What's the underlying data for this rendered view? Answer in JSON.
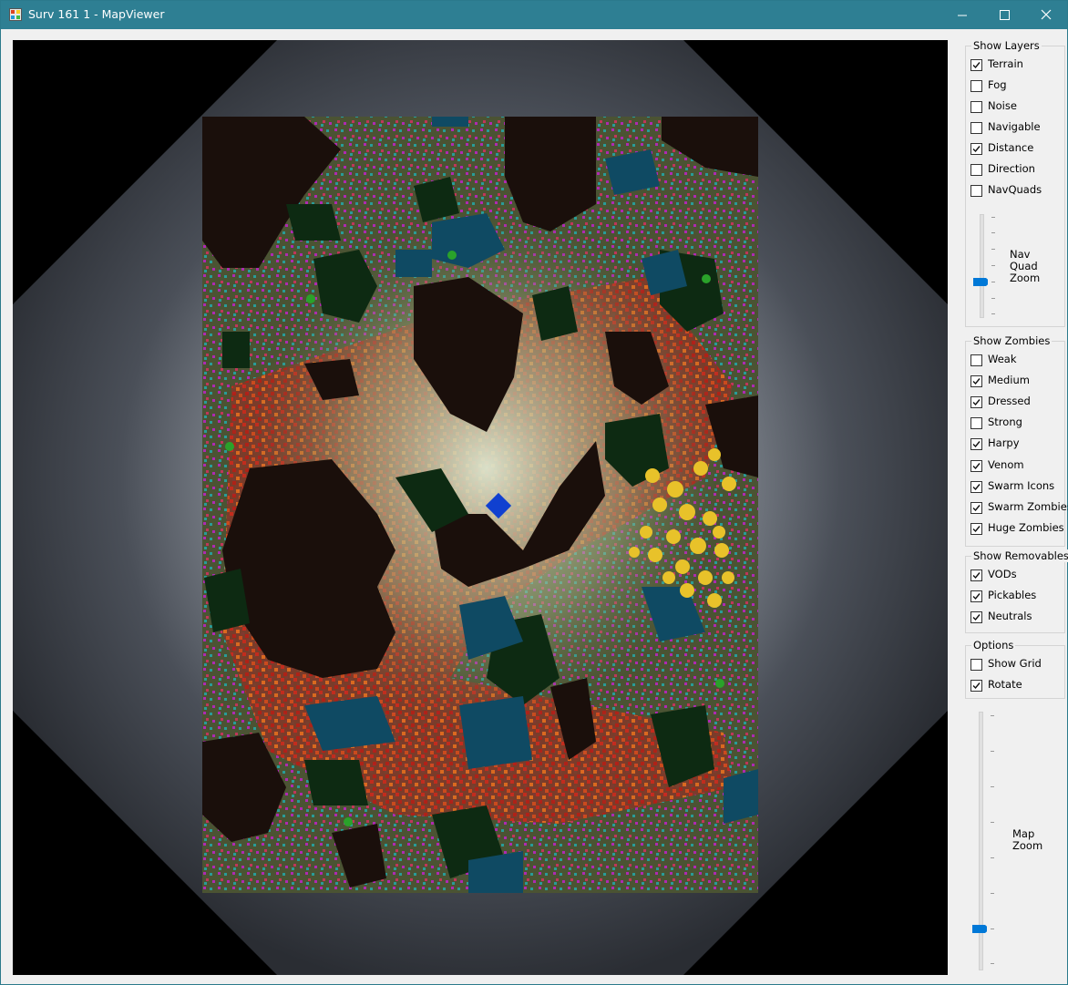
{
  "window": {
    "title": "Surv 161 1 - MapViewer",
    "minimize": "—",
    "maximize": "☐",
    "close": "✕"
  },
  "show_layers": {
    "title": "Show Layers",
    "items": [
      {
        "label": "Terrain",
        "checked": true
      },
      {
        "label": "Fog",
        "checked": false
      },
      {
        "label": "Noise",
        "checked": false
      },
      {
        "label": "Navigable",
        "checked": false
      },
      {
        "label": "Distance",
        "checked": true
      },
      {
        "label": "Direction",
        "checked": false
      },
      {
        "label": "NavQuads",
        "checked": false
      }
    ],
    "slider_label_1": "Nav",
    "slider_label_2": "Quad",
    "slider_label_3": "Zoom"
  },
  "show_zombies": {
    "title": "Show Zombies",
    "items": [
      {
        "label": "Weak",
        "checked": false
      },
      {
        "label": "Medium",
        "checked": true
      },
      {
        "label": "Dressed",
        "checked": true
      },
      {
        "label": "Strong",
        "checked": false
      },
      {
        "label": "Harpy",
        "checked": true
      },
      {
        "label": "Venom",
        "checked": true
      },
      {
        "label": "Swarm Icons",
        "checked": true
      },
      {
        "label": "Swarm Zombies",
        "checked": true
      },
      {
        "label": "Huge Zombies",
        "checked": true
      }
    ]
  },
  "show_removables": {
    "title": "Show Removables",
    "items": [
      {
        "label": "VODs",
        "checked": true
      },
      {
        "label": "Pickables",
        "checked": true
      },
      {
        "label": "Neutrals",
        "checked": true
      }
    ]
  },
  "options": {
    "title": "Options",
    "items": [
      {
        "label": "Show Grid",
        "checked": false
      },
      {
        "label": "Rotate",
        "checked": true
      }
    ]
  },
  "map_zoom": {
    "label_1": "Map",
    "label_2": "Zoom"
  },
  "colors": {
    "titlebar": "#2e7f93",
    "accent": "#0078d7",
    "terrain_dark": "#1a0f0b",
    "forest": "#0d2a12",
    "water": "#0f4a63",
    "grass": "#4a5530",
    "zombie_red": "#b52318",
    "zombie_orange": "#d9601a",
    "zombie_magenta": "#c020c8",
    "zombie_cyan": "#22a8a8",
    "huge_zombie_yellow": "#e8c22a",
    "player_blue": "#1040d0",
    "pickable_green": "#2aa22a"
  }
}
